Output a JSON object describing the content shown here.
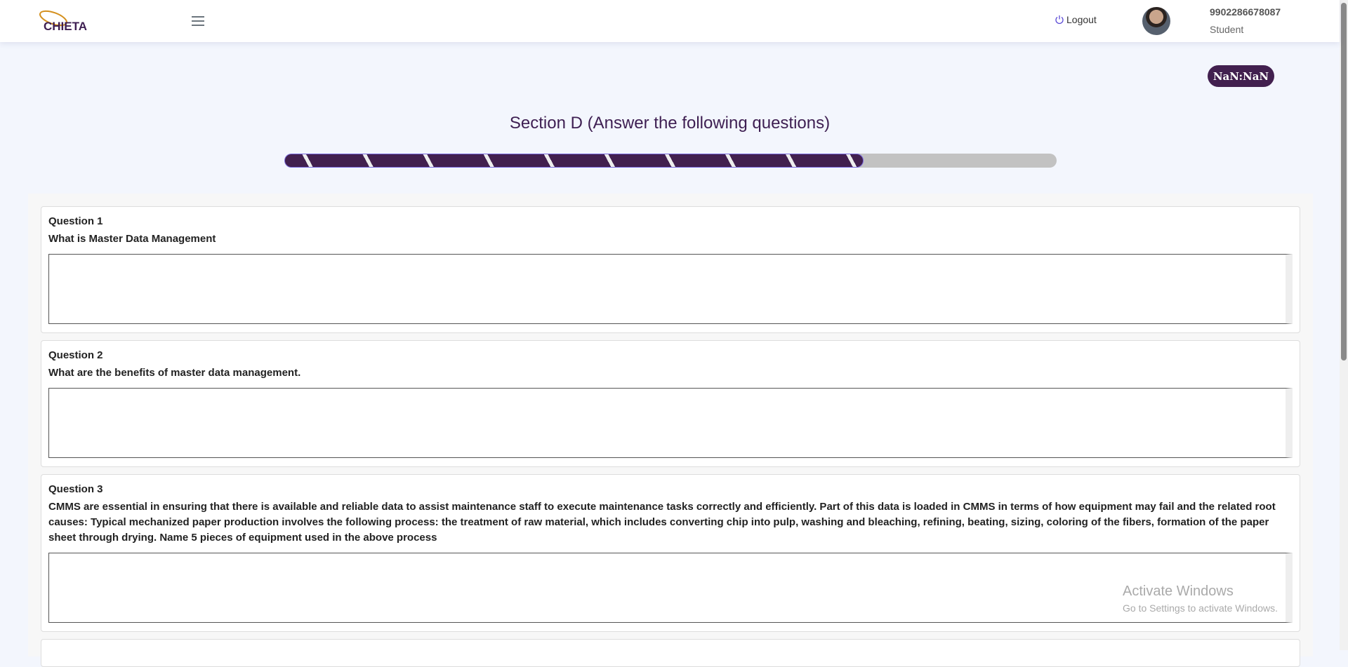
{
  "header": {
    "logo_text": "CHIETA",
    "logout_label": "Logout",
    "user_id": "9902286678087",
    "user_role": "Student"
  },
  "timer": "NaN:NaN",
  "section_title": "Section D (Answer the following questions)",
  "progress": {
    "fraction": 0.75
  },
  "questions": [
    {
      "number": "Question 1",
      "text": "What is Master Data Management",
      "answer": ""
    },
    {
      "number": "Question 2",
      "text": "What are the benefits of master data management.",
      "answer": ""
    },
    {
      "number": "Question 3",
      "text": "CMMS are essential in ensuring that there is available and reliable data to assist maintenance staff to execute maintenance tasks correctly and efficiently. Part of this data is loaded in CMMS in terms of how equipment may fail and the related root causes: Typical mechanized paper production involves the following process: the treatment of raw material, which includes converting chip into pulp, washing and bleaching, refining, beating, sizing, coloring of the fibers, formation of the paper sheet through drying. Name 5 pieces of equipment used in the above process",
      "answer": ""
    }
  ],
  "watermark": {
    "title": "Activate Windows",
    "subtitle": "Go to Settings to activate Windows."
  }
}
